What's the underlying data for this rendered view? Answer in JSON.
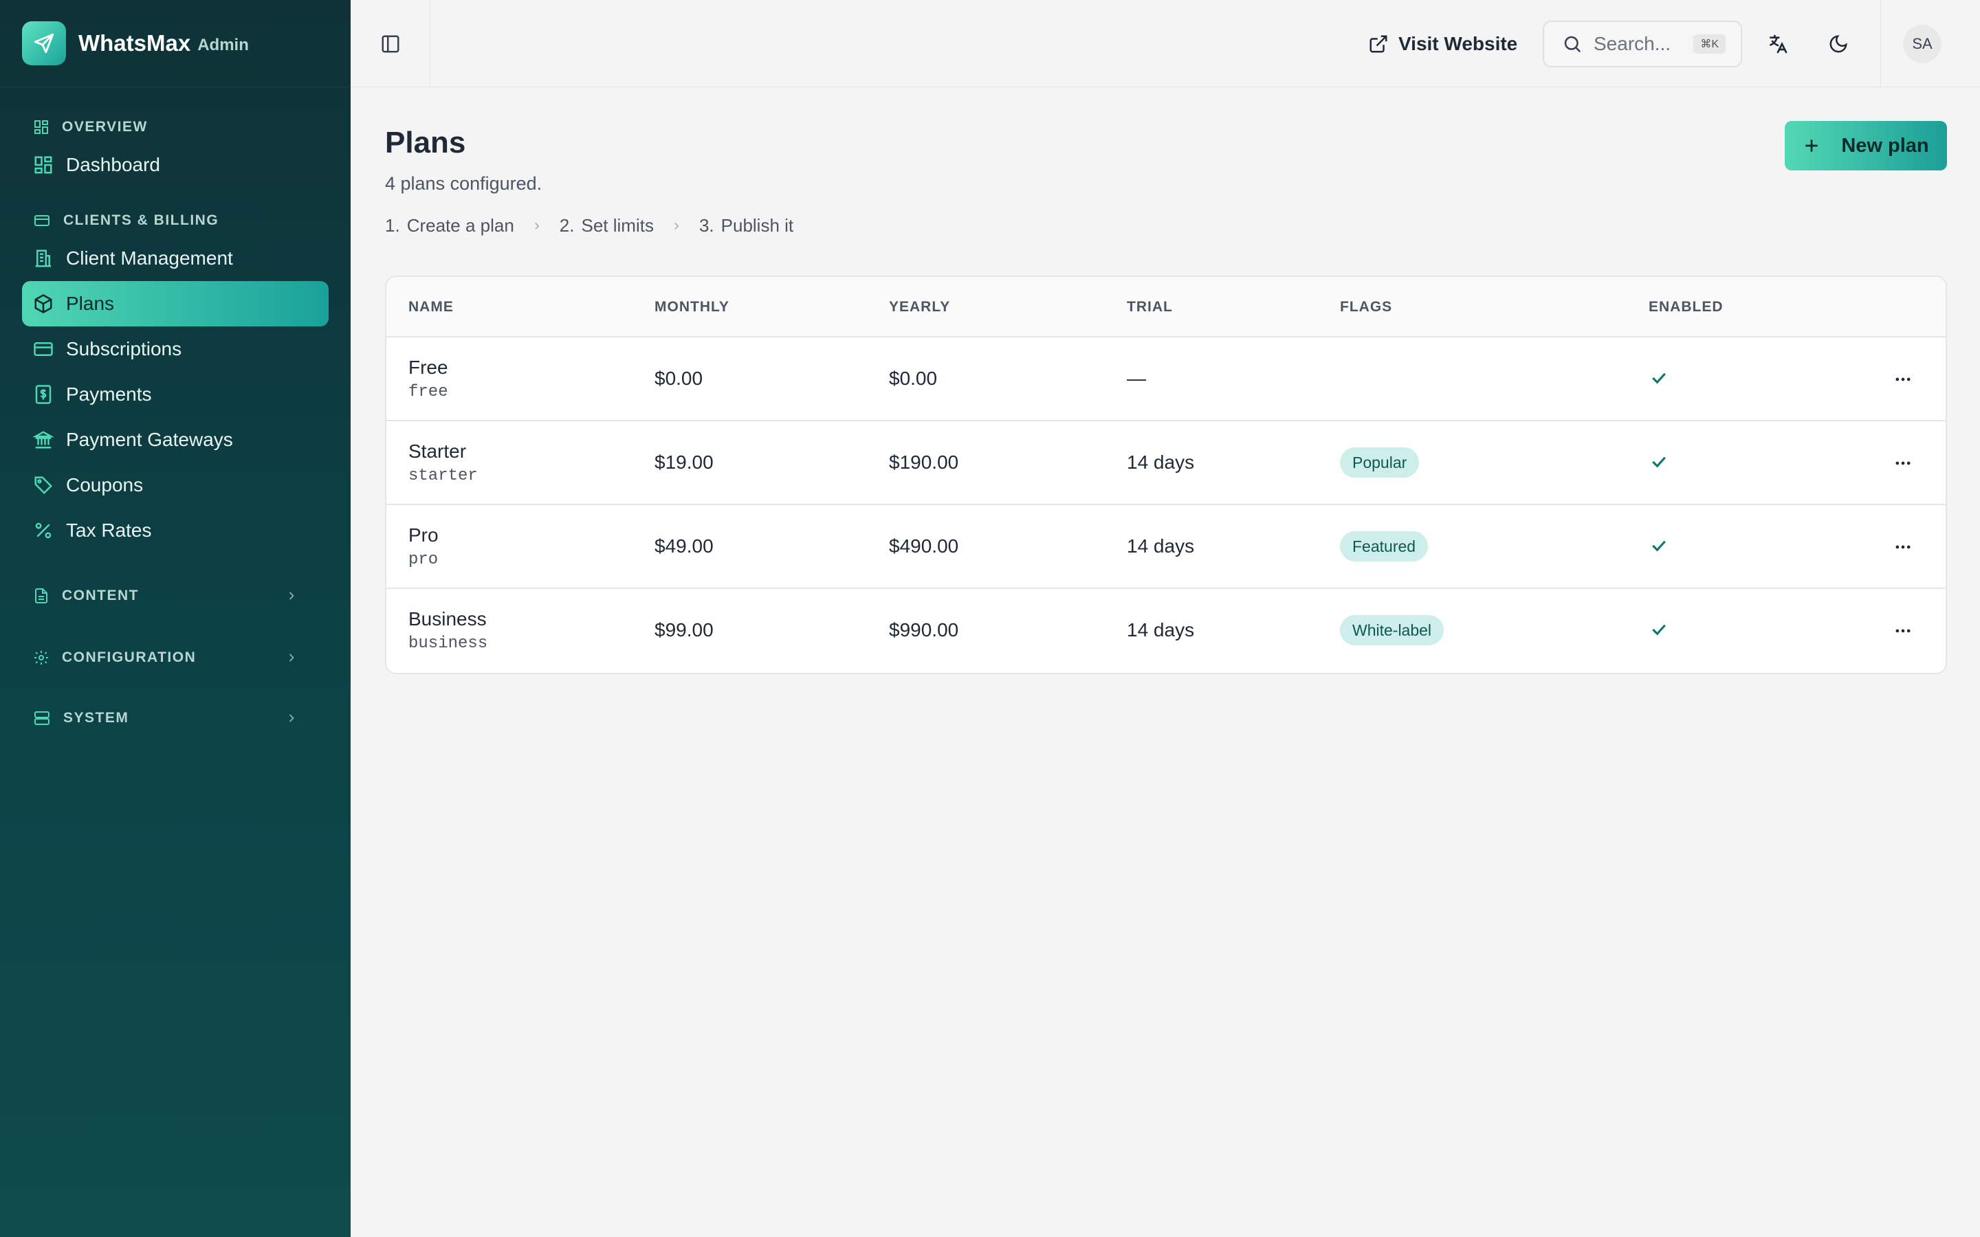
{
  "brand": {
    "name": "WhatsMax",
    "sub": "Admin"
  },
  "sidebar": {
    "overview": {
      "label": "OVERVIEW",
      "items": [
        {
          "label": "Dashboard"
        }
      ]
    },
    "billing": {
      "label": "CLIENTS & BILLING",
      "items": [
        {
          "label": "Client Management"
        },
        {
          "label": "Plans"
        },
        {
          "label": "Subscriptions"
        },
        {
          "label": "Payments"
        },
        {
          "label": "Payment Gateways"
        },
        {
          "label": "Coupons"
        },
        {
          "label": "Tax Rates"
        }
      ]
    },
    "content": {
      "label": "CONTENT"
    },
    "configuration": {
      "label": "CONFIGURATION"
    },
    "system": {
      "label": "SYSTEM"
    },
    "active_item": "Plans"
  },
  "topbar": {
    "visit_label": "Visit Website",
    "search_placeholder": "Search...",
    "search_shortcut": "⌘K",
    "avatar": "SA"
  },
  "page": {
    "title": "Plans",
    "subtitle": "4 plans configured.",
    "new_button": "New plan",
    "steps": [
      {
        "num": "1.",
        "label": "Create a plan"
      },
      {
        "num": "2.",
        "label": "Set limits"
      },
      {
        "num": "3.",
        "label": "Publish it"
      }
    ]
  },
  "table": {
    "headers": {
      "name": "NAME",
      "monthly": "MONTHLY",
      "yearly": "YEARLY",
      "trial": "TRIAL",
      "flags": "FLAGS",
      "enabled": "ENABLED"
    },
    "rows": [
      {
        "name": "Free",
        "slug": "free",
        "monthly": "$0.00",
        "yearly": "$0.00",
        "trial": "—",
        "flag": "",
        "enabled": true
      },
      {
        "name": "Starter",
        "slug": "starter",
        "monthly": "$19.00",
        "yearly": "$190.00",
        "trial": "14 days",
        "flag": "Popular",
        "enabled": true
      },
      {
        "name": "Pro",
        "slug": "pro",
        "monthly": "$49.00",
        "yearly": "$490.00",
        "trial": "14 days",
        "flag": "Featured",
        "enabled": true
      },
      {
        "name": "Business",
        "slug": "business",
        "monthly": "$99.00",
        "yearly": "$990.00",
        "trial": "14 days",
        "flag": "White-label",
        "enabled": true
      }
    ]
  },
  "colors": {
    "accent": "#1aa19a",
    "accent_light": "#53d8b4",
    "sidebar_bg": "#0e3237",
    "badge_bg": "#cdeeea"
  }
}
